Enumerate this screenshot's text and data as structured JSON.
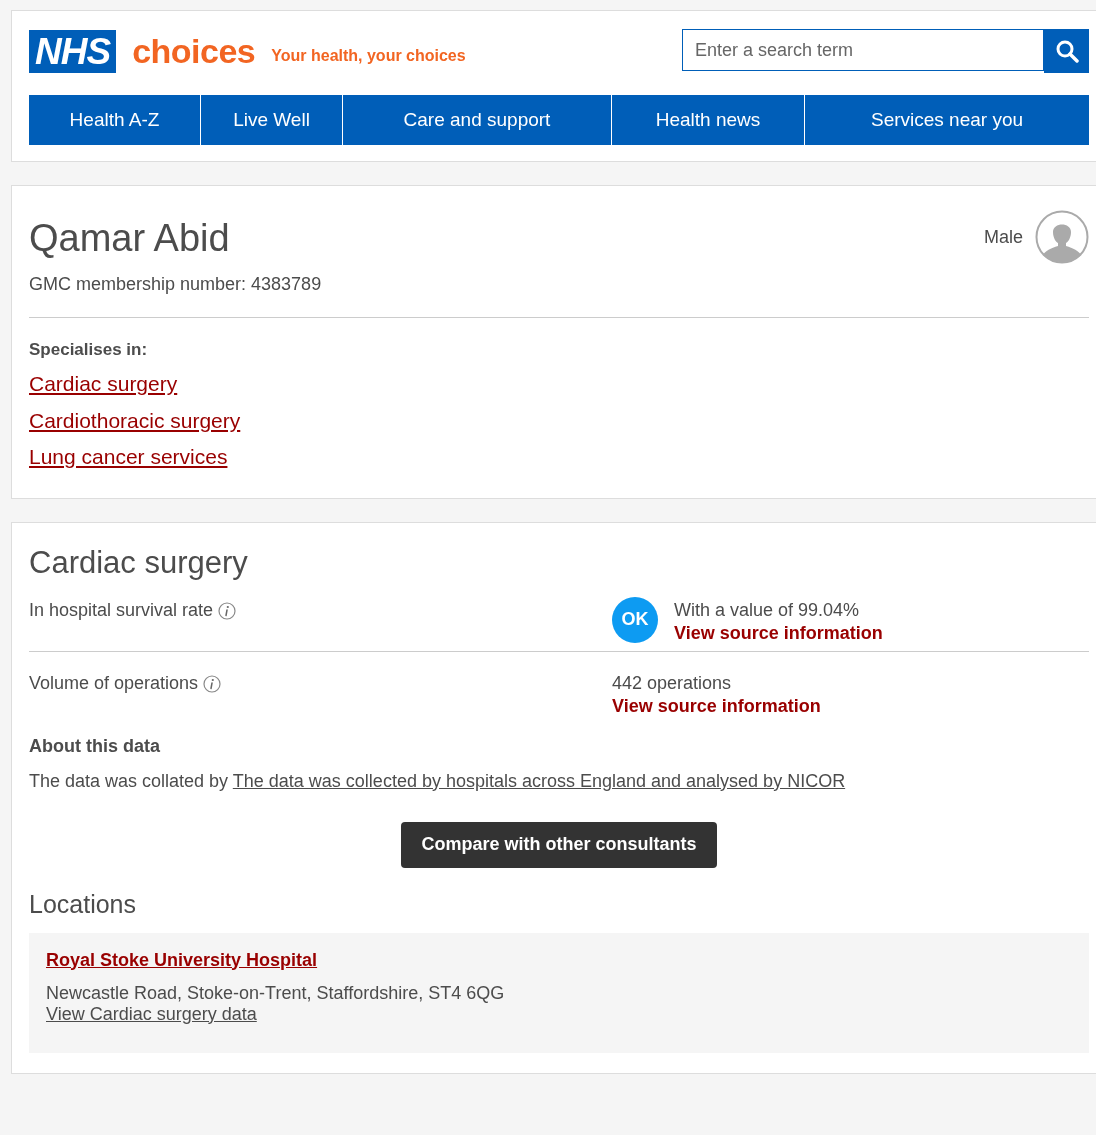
{
  "header": {
    "logo": {
      "nhs": "NHS",
      "brand": "choices"
    },
    "tagline": "Your health, your choices",
    "search": {
      "placeholder": "Enter a search term"
    },
    "nav": [
      "Health A-Z",
      "Live Well",
      "Care and support",
      "Health news",
      "Services near you"
    ]
  },
  "profile": {
    "name": "Qamar Abid",
    "membership": "GMC membership number: 4383789",
    "gender": "Male",
    "specialises_heading": "Specialises in:",
    "specialties": [
      "Cardiac surgery",
      "Cardiothoracic surgery",
      "Lung cancer services"
    ]
  },
  "section": {
    "title": "Cardiac surgery",
    "metrics": [
      {
        "label": "In hospital survival rate",
        "badge": "OK",
        "value": "With a value of 99.04%",
        "link": "View source information"
      },
      {
        "label": "Volume of operations",
        "value": "442 operations",
        "link": "View source information"
      }
    ],
    "about": {
      "heading": "About this data",
      "text": "The data was collated by",
      "link": "The data was collected by hospitals across England and analysed by NICOR"
    },
    "compare_button": "Compare with other consultants",
    "locations_heading": "Locations",
    "locations": [
      {
        "name": "Royal Stoke University Hospital",
        "address": "Newcastle Road, Stoke-on-Trent, Staffordshire, ST4 6QG",
        "link": "View Cardiac surgery data"
      }
    ]
  }
}
